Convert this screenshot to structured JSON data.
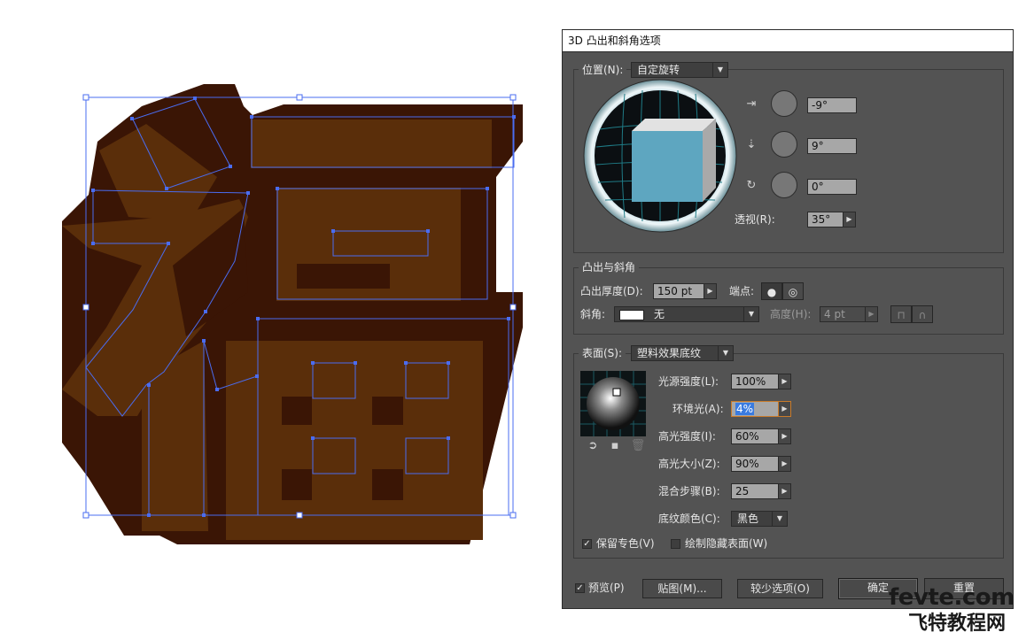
{
  "dialog": {
    "title": "3D 凸出和斜角选项",
    "position_group": {
      "label": "位置(N):",
      "preset": "自定旋转",
      "x_rotation": "-9°",
      "y_rotation": "9°",
      "z_rotation": "0°",
      "perspective_label": "透视(R):",
      "perspective": "35°"
    },
    "extrude_group": {
      "legend": "凸出与斜角",
      "depth_label": "凸出厚度(D):",
      "depth": "150 pt",
      "cap_label": "端点:",
      "bevel_label": "斜角:",
      "bevel": "无",
      "height_label": "高度(H):",
      "height": "4 pt"
    },
    "surface_group": {
      "label": "表面(S):",
      "surface": "塑料效果底纹",
      "light_intensity_label": "光源强度(L):",
      "light_intensity": "100%",
      "ambient_label": "环境光(A):",
      "ambient": "4%",
      "highlight_intensity_label": "高光强度(I):",
      "highlight_intensity": "60%",
      "highlight_size_label": "高光大小(Z):",
      "highlight_size": "90%",
      "blend_steps_label": "混合步骤(B):",
      "blend_steps": "25",
      "shade_color_label": "底纹颜色(C):",
      "shade_color": "黑色",
      "preserve_spot_label": "保留专色(V)",
      "draw_hidden_label": "绘制隐藏表面(W)"
    },
    "footer": {
      "preview_label": "预览(P)",
      "map_art_button": "贴图(M)...",
      "fewer_options_button": "较少选项(O)",
      "ok_button": "确定",
      "reset_button": "重置"
    }
  },
  "watermark": {
    "line1": "fevte.com",
    "line2": "飞特教程网"
  },
  "colors": {
    "glyph_face": "#5a2e0a",
    "glyph_side": "#3a1505",
    "selection": "#4a6cf0",
    "dialog_bg": "#535353",
    "cube_face": "#5ea6c0"
  }
}
